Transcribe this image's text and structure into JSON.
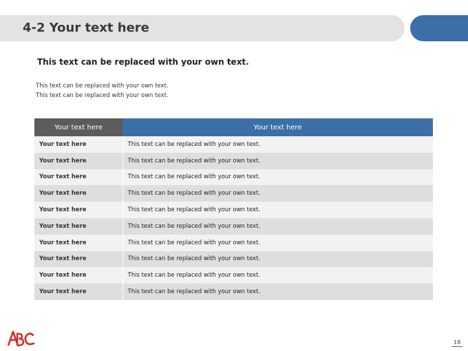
{
  "slide": {
    "title": "4-2 Your text here",
    "subtitle": "This text can be replaced with your own text.",
    "body_lines": [
      "This text can be replaced with your own text.",
      "This text can be replaced with your own text."
    ],
    "page_number": "18",
    "logo_text": "ABC"
  },
  "table": {
    "headers": [
      "Your text here",
      "Your text here"
    ],
    "rows": [
      [
        "Your text here",
        "This text can be replaced with your own text."
      ],
      [
        "Your text here",
        "This text can be replaced with your own text."
      ],
      [
        "Your text here",
        "This text can be replaced with your own text."
      ],
      [
        "Your text here",
        "This text can be replaced with your own text."
      ],
      [
        "Your text here",
        "This text can be replaced with your own text."
      ],
      [
        "Your text here",
        "This text can be replaced with your own text."
      ],
      [
        "Your text here",
        "This text can be replaced with your own text."
      ],
      [
        "Your text here",
        "This text can be replaced with your own text."
      ],
      [
        "Your text here",
        "This text can be replaced with your own text."
      ],
      [
        "Your text here",
        "This text can be replaced with your own text."
      ]
    ]
  },
  "colors": {
    "accent_blue": "#3c6fa7",
    "header_gray": "#5c5c5c",
    "title_bar": "#e3e3e3",
    "logo_red": "#d7261e"
  }
}
